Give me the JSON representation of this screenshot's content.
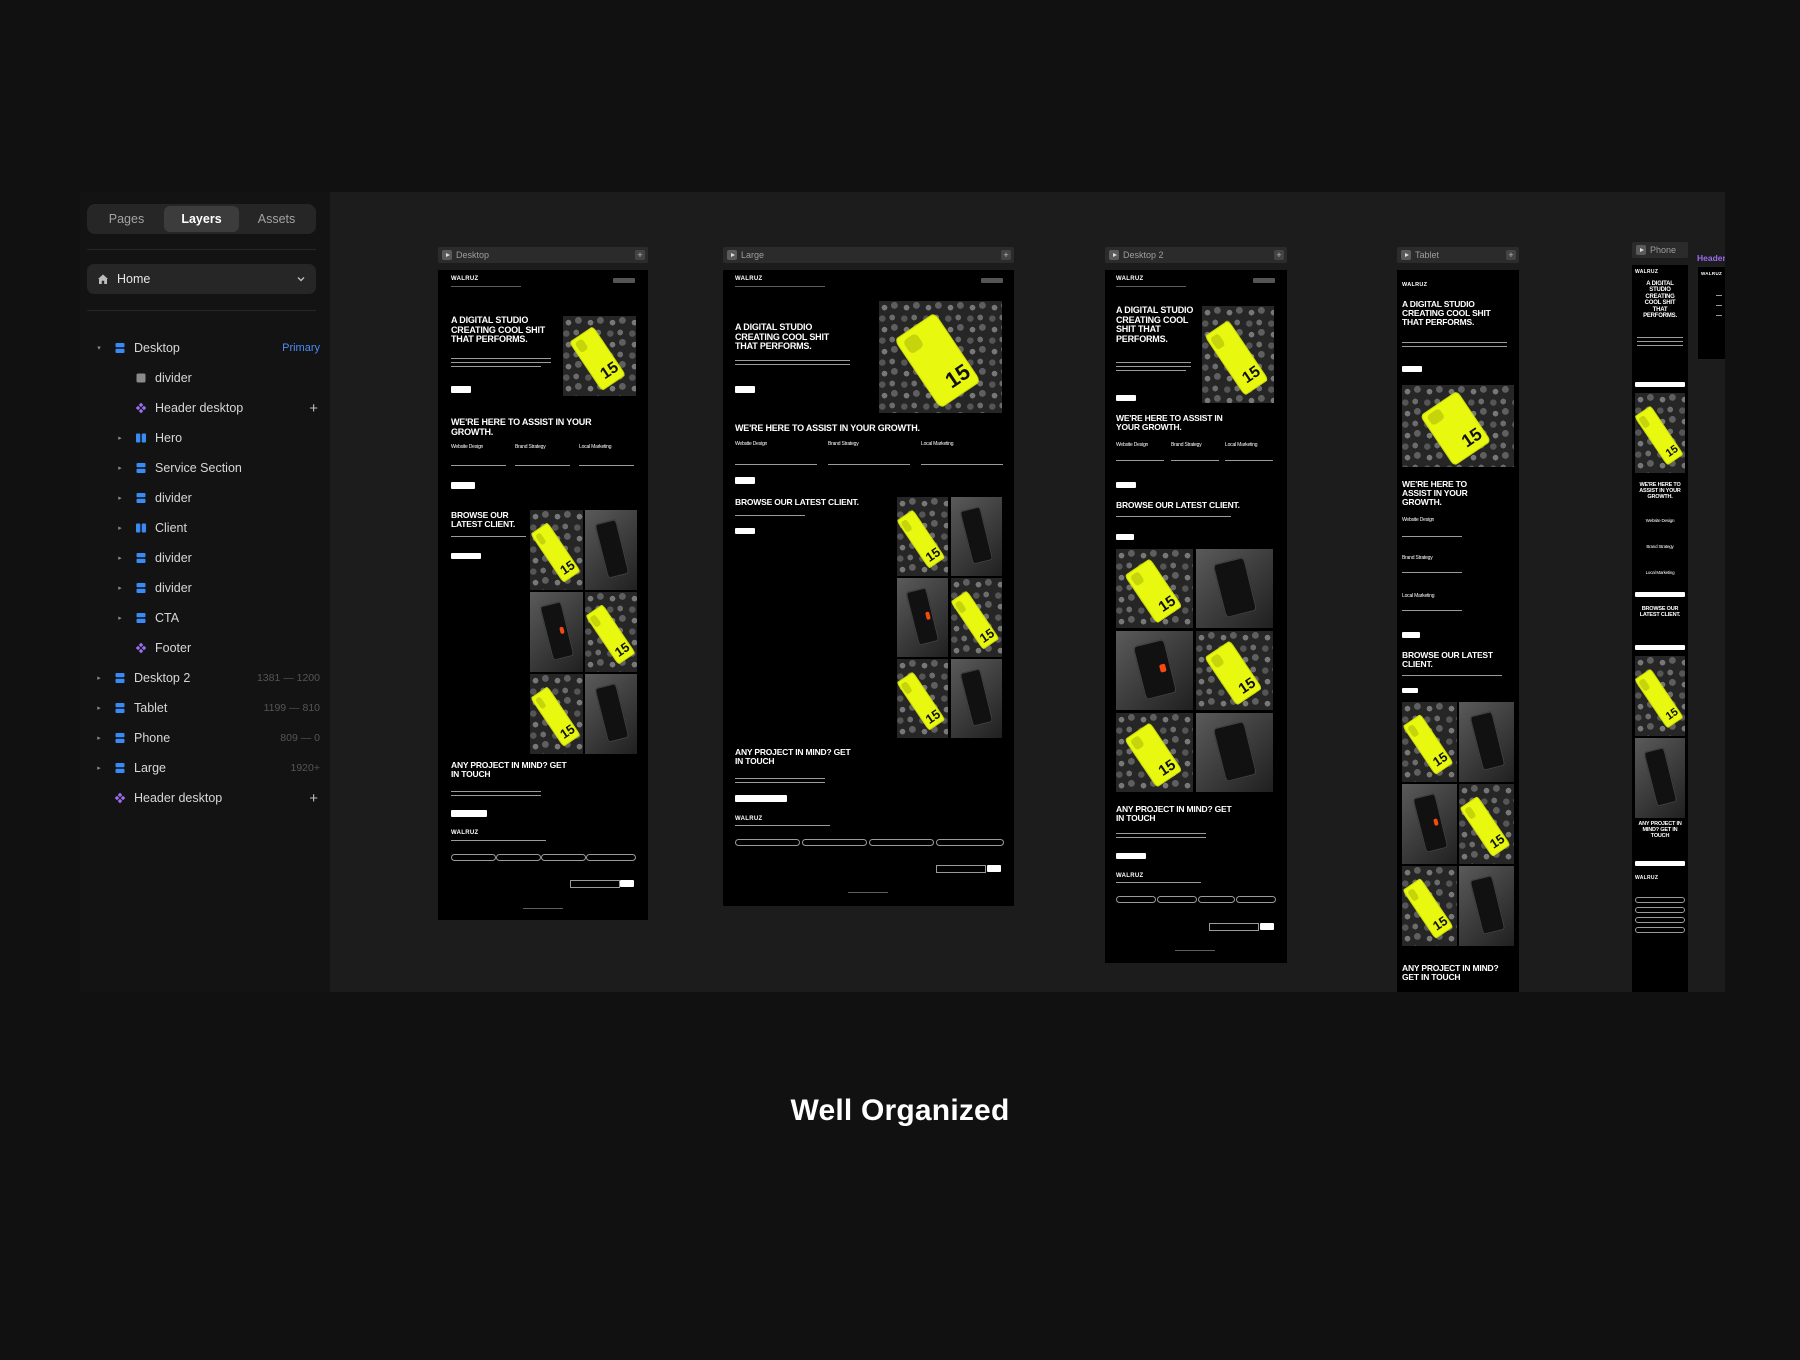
{
  "panel": {
    "tabs": [
      {
        "label": "Pages",
        "active": false
      },
      {
        "label": "Layers",
        "active": true
      },
      {
        "label": "Assets",
        "active": false
      }
    ],
    "page_select": {
      "label": "Home",
      "icon": "home-icon"
    },
    "layers": [
      {
        "label": "Desktop",
        "meta": "Primary",
        "type": "stack",
        "depth": 0,
        "expanded": true
      },
      {
        "label": "divider",
        "meta": "",
        "type": "frame",
        "depth": 1
      },
      {
        "label": "Header desktop",
        "meta": "+",
        "type": "component",
        "depth": 1
      },
      {
        "label": "Hero",
        "meta": "",
        "type": "columns",
        "depth": 1,
        "collapsed": true
      },
      {
        "label": "Service Section",
        "meta": "",
        "type": "stack",
        "depth": 1,
        "collapsed": true
      },
      {
        "label": "divider",
        "meta": "",
        "type": "stack",
        "depth": 1,
        "collapsed": true
      },
      {
        "label": "Client",
        "meta": "",
        "type": "columns",
        "depth": 1,
        "collapsed": true
      },
      {
        "label": "divider",
        "meta": "",
        "type": "stack",
        "depth": 1,
        "collapsed": true
      },
      {
        "label": "divider",
        "meta": "",
        "type": "stack",
        "depth": 1,
        "collapsed": true
      },
      {
        "label": "CTA",
        "meta": "",
        "type": "stack",
        "depth": 1,
        "collapsed": true
      },
      {
        "label": "Footer",
        "meta": "",
        "type": "component",
        "depth": 1
      },
      {
        "label": "Desktop 2",
        "meta": "1381 — 1200",
        "type": "stack",
        "depth": 0,
        "collapsed": true
      },
      {
        "label": "Tablet",
        "meta": "1199 — 810",
        "type": "stack",
        "depth": 0,
        "collapsed": true
      },
      {
        "label": "Phone",
        "meta": "809 — 0",
        "type": "stack",
        "depth": 0,
        "collapsed": true
      },
      {
        "label": "Large",
        "meta": "1920+",
        "type": "stack",
        "depth": 0,
        "collapsed": true
      },
      {
        "label": "Header desktop",
        "meta": "+",
        "type": "component",
        "depth": 0
      }
    ]
  },
  "canvas": {
    "frames": [
      {
        "label": "Desktop"
      },
      {
        "label": "Large"
      },
      {
        "label": "Desktop 2"
      },
      {
        "label": "Tablet"
      },
      {
        "label": "Phone"
      }
    ],
    "extra_label": "Header",
    "site": {
      "logo": "WALRUZ",
      "hero_title": "A DIGITAL STUDIO CREATING COOL SHIT THAT PERFORMS.",
      "services_title": "WE'RE HERE TO ASSIST IN YOUR GROWTH.",
      "services": [
        "Website Design",
        "Brand Strategy",
        "Local Marketing"
      ],
      "clients_title": "BROWSE OUR LATEST CLIENT.",
      "cta_title": "ANY PROJECT IN MIND? GET IN TOUCH"
    }
  },
  "footer_title": "Well Organized",
  "colors": {
    "background": "#111111",
    "canvas": "#1c1c1c",
    "accent_blue": "#4b8cf5",
    "component_purple": "#9b6cf0",
    "phone_yellow": "#e8f90f"
  }
}
